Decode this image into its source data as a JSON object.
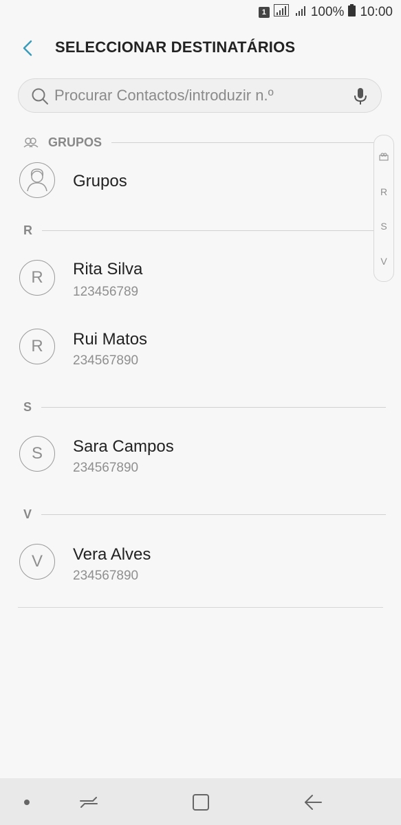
{
  "status_bar": {
    "sim": "1",
    "battery": "100%",
    "time": "10:00"
  },
  "header": {
    "title": "SELECCIONAR DESTINATÁRIOS"
  },
  "search": {
    "placeholder": "Procurar Contactos/introduzir n.º",
    "value": ""
  },
  "sections": {
    "groups": "GRUPOS",
    "r": "R",
    "s": "S",
    "v": "V"
  },
  "groups_item": {
    "label": "Grupos"
  },
  "contacts": [
    {
      "initial": "R",
      "name": "Rita Silva",
      "phone": "123456789"
    },
    {
      "initial": "R",
      "name": "Rui Matos",
      "phone": "234567890"
    },
    {
      "initial": "S",
      "name": "Sara Campos",
      "phone": "234567890"
    },
    {
      "initial": "V",
      "name": "Vera Alves",
      "phone": "234567890"
    }
  ],
  "index_bar": {
    "items": [
      "R",
      "S",
      "V"
    ]
  },
  "colors": {
    "accent": "#3a9bb8",
    "background": "#f7f7f7"
  }
}
